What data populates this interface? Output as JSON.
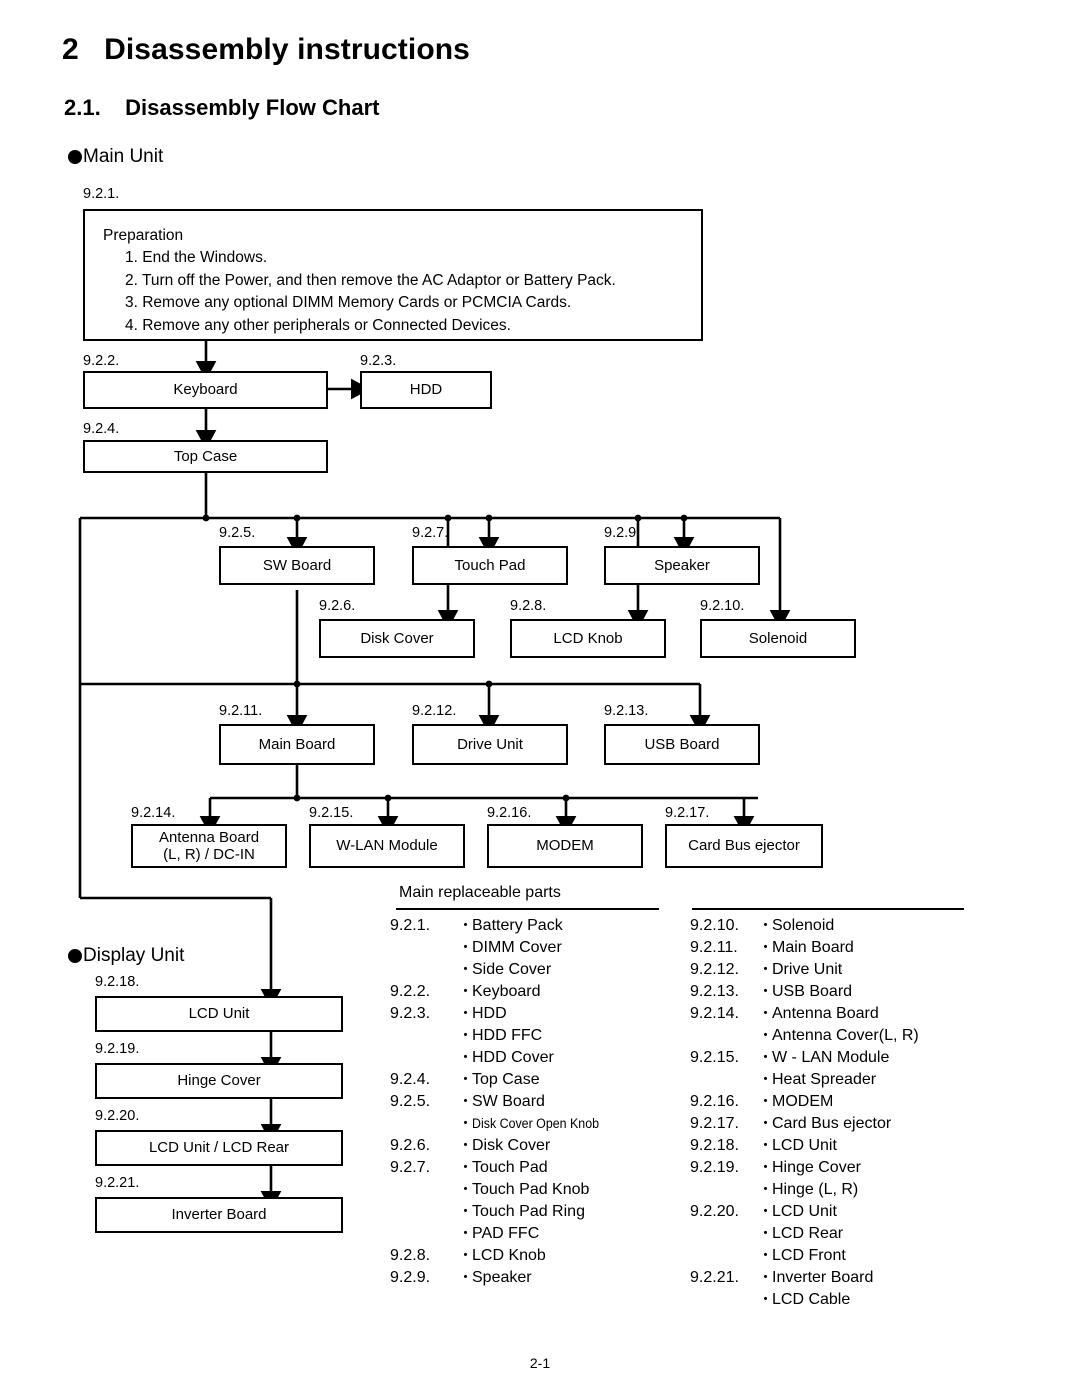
{
  "document": {
    "chapter_number": "2",
    "chapter_title": "Disassembly instructions",
    "section_number": "2.1.",
    "section_title": "Disassembly Flow Chart",
    "footer": "2-1"
  },
  "sections": {
    "main_unit": "Main Unit",
    "display_unit": "Display Unit"
  },
  "preparation": {
    "tag": "9.2.1.",
    "heading": "Preparation",
    "steps": [
      "1. End the Windows.",
      "2. Turn off the Power, and then remove the AC Adaptor or Battery Pack.",
      "3. Remove any optional DIMM Memory Cards or PCMCIA Cards.",
      "4. Remove any other peripherals or Connected Devices."
    ]
  },
  "flow_boxes": {
    "keyboard": {
      "tag": "9.2.2.",
      "label": "Keyboard"
    },
    "hdd": {
      "tag": "9.2.3.",
      "label": "HDD"
    },
    "top_case": {
      "tag": "9.2.4.",
      "label": "Top Case"
    },
    "sw_board": {
      "tag": "9.2.5.",
      "label": "SW Board"
    },
    "disk_cover": {
      "tag": "9.2.6.",
      "label": "Disk Cover"
    },
    "touch_pad": {
      "tag": "9.2.7.",
      "label": "Touch Pad"
    },
    "lcd_knob": {
      "tag": "9.2.8.",
      "label": "LCD Knob"
    },
    "speaker": {
      "tag": "9.2.9.",
      "label": "Speaker"
    },
    "solenoid": {
      "tag": "9.2.10.",
      "label": "Solenoid"
    },
    "main_board": {
      "tag": "9.2.11.",
      "label": "Main Board"
    },
    "drive_unit": {
      "tag": "9.2.12.",
      "label": "Drive Unit"
    },
    "usb_board": {
      "tag": "9.2.13.",
      "label": "USB Board"
    },
    "antenna_board": {
      "tag": "9.2.14.",
      "label_line1": "Antenna Board",
      "label_line2": "(L, R) / DC-IN"
    },
    "wlan_module": {
      "tag": "9.2.15.",
      "label": "W-LAN Module"
    },
    "modem": {
      "tag": "9.2.16.",
      "label": "MODEM"
    },
    "card_bus_ejector": {
      "tag": "9.2.17.",
      "label": "Card Bus ejector"
    },
    "lcd_unit": {
      "tag": "9.2.18.",
      "label": "LCD Unit"
    },
    "hinge_cover": {
      "tag": "9.2.19.",
      "label": "Hinge Cover"
    },
    "lcd_unit_rear": {
      "tag": "9.2.20.",
      "label": "LCD Unit / LCD Rear"
    },
    "inverter_board": {
      "tag": "9.2.21.",
      "label": "Inverter Board"
    }
  },
  "parts_list": {
    "title": "Main replaceable parts",
    "bullet": "・",
    "left": [
      {
        "num": "9.2.1.",
        "label": "Battery Pack"
      },
      {
        "num": "",
        "label": "DIMM Cover"
      },
      {
        "num": "",
        "label": "Side Cover"
      },
      {
        "num": "9.2.2.",
        "label": "Keyboard"
      },
      {
        "num": "9.2.3.",
        "label": "HDD"
      },
      {
        "num": "",
        "label": "HDD FFC"
      },
      {
        "num": "",
        "label": "HDD Cover"
      },
      {
        "num": "9.2.4.",
        "label": "Top Case"
      },
      {
        "num": "9.2.5.",
        "label": "SW Board"
      },
      {
        "num": "",
        "label": "Disk Cover Open Knob",
        "condensed": true
      },
      {
        "num": "9.2.6.",
        "label": "Disk Cover"
      },
      {
        "num": "9.2.7.",
        "label": "Touch Pad"
      },
      {
        "num": "",
        "label": "Touch Pad Knob"
      },
      {
        "num": "",
        "label": "Touch Pad Ring"
      },
      {
        "num": "",
        "label": "PAD FFC"
      },
      {
        "num": "9.2.8.",
        "label": "LCD Knob"
      },
      {
        "num": "9.2.9.",
        "label": "Speaker"
      }
    ],
    "right": [
      {
        "num": "9.2.10.",
        "label": "Solenoid"
      },
      {
        "num": "9.2.11.",
        "label": "Main Board"
      },
      {
        "num": "9.2.12.",
        "label": "Drive Unit"
      },
      {
        "num": "9.2.13.",
        "label": "USB Board"
      },
      {
        "num": "9.2.14.",
        "label": "Antenna Board"
      },
      {
        "num": "",
        "label": "Antenna Cover(L, R)"
      },
      {
        "num": "9.2.15.",
        "label": "W - LAN Module"
      },
      {
        "num": "",
        "label": "Heat Spreader"
      },
      {
        "num": "9.2.16.",
        "label": "MODEM"
      },
      {
        "num": "9.2.17.",
        "label": "Card Bus ejector"
      },
      {
        "num": "9.2.18.",
        "label": "LCD Unit"
      },
      {
        "num": "9.2.19.",
        "label": "Hinge Cover"
      },
      {
        "num": "",
        "label": "Hinge (L, R)"
      },
      {
        "num": "9.2.20.",
        "label": "LCD Unit"
      },
      {
        "num": "",
        "label": "LCD Rear"
      },
      {
        "num": "",
        "label": "LCD Front"
      },
      {
        "num": "9.2.21.",
        "label": "Inverter Board"
      },
      {
        "num": "",
        "label": "LCD Cable"
      }
    ]
  }
}
